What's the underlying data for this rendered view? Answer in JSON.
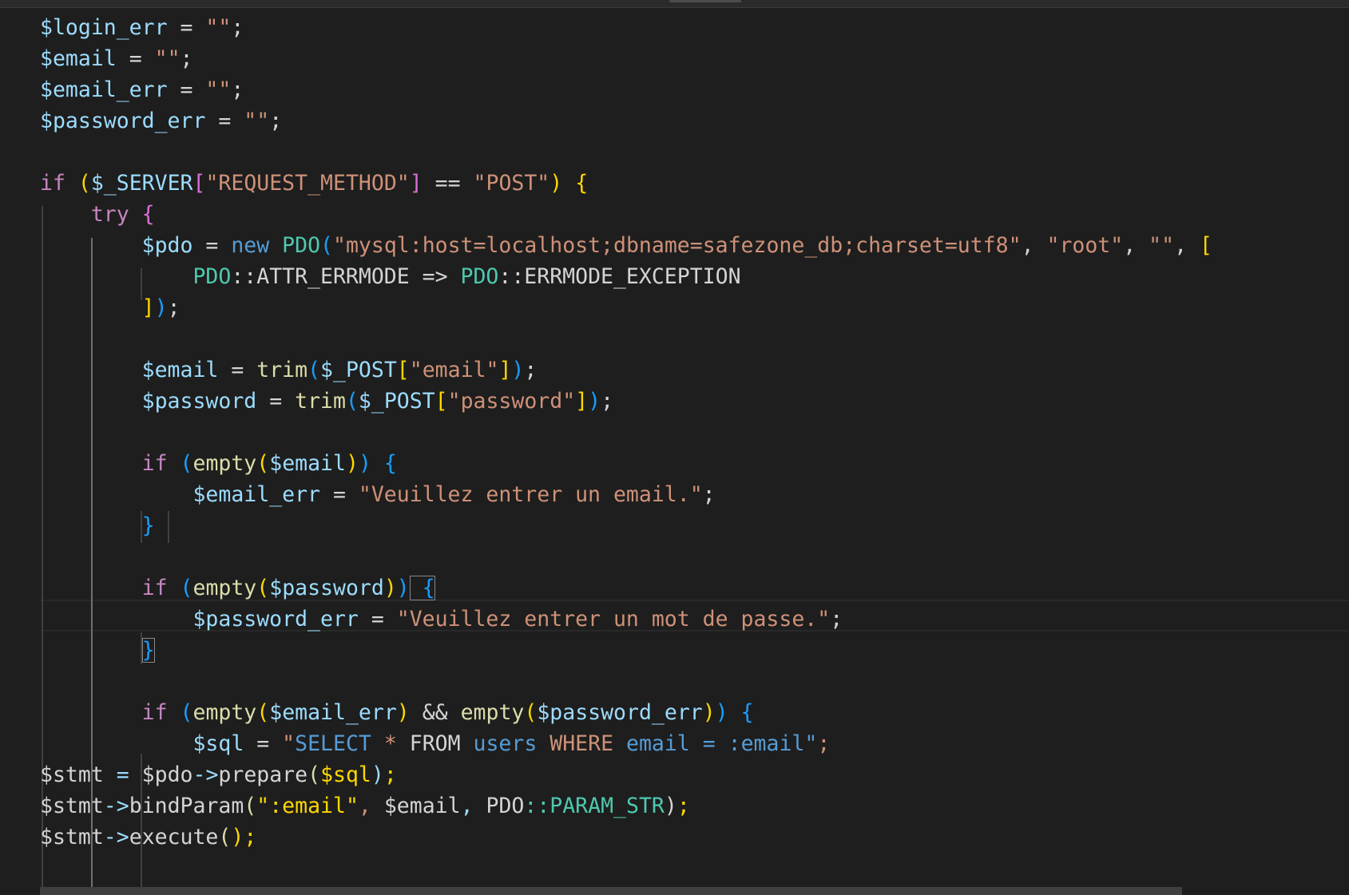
{
  "editor": {
    "language": "php",
    "theme_colors": {
      "background": "#1e1e1e",
      "variable": "#9cdcfe",
      "keyword_control": "#c586c0",
      "keyword_storage": "#569cd6",
      "string": "#ce9178",
      "function": "#dcdcaa",
      "class": "#4ec9b0",
      "bracket_level_1": "#ffd700",
      "bracket_level_2": "#da70d6",
      "bracket_level_3": "#179fff"
    },
    "code_lines": [
      "$login_err = \"\";",
      "$email = \"\";",
      "$email_err = \"\";",
      "$password_err = \"\";",
      "",
      "if ($_SERVER[\"REQUEST_METHOD\"] == \"POST\") {",
      "    try {",
      "        $pdo = new PDO(\"mysql:host=localhost;dbname=safezone_db;charset=utf8\", \"root\", \"\", [",
      "            PDO::ATTR_ERRMODE => PDO::ERRMODE_EXCEPTION",
      "        ]);",
      "",
      "        $email = trim($_POST[\"email\"]);",
      "        $password = trim($_POST[\"password\"]);",
      "",
      "        if (empty($email)) {",
      "            $email_err = \"Veuillez entrer un email.\";",
      "        }",
      "",
      "        if (empty($password)) {",
      "            $password_err = \"Veuillez entrer un mot de passe.\";",
      "        }",
      "",
      "        if (empty($email_err) && empty($password_err)) {",
      "            $sql = \"SELECT * FROM users WHERE email = :email\";",
      "            $stmt = $pdo->prepare($sql);",
      "            $stmt->bindParam(\":email\", $email, PDO::PARAM_STR);",
      "            $stmt->execute();"
    ]
  }
}
